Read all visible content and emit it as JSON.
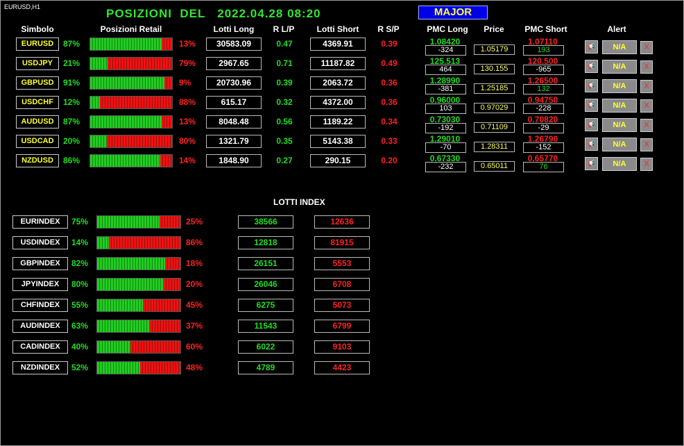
{
  "chart_label": "EURUSD,H1",
  "title": "POSIZIONI  DEL   2022.04.28 08:20",
  "group_button": "MAJOR",
  "headers": {
    "simbolo": "Simbolo",
    "posizioni_retail": "Posizioni Retail",
    "lotti_long": "Lotti Long",
    "r_lp": "R L/P",
    "lotti_short": "Lotti Short",
    "r_sp": "R S/P",
    "pmc_long": "PMC Long",
    "price": "Price",
    "pmc_short": "PMC Short",
    "alert": "Alert"
  },
  "rows": [
    {
      "symbol": "EURUSD",
      "long_pct": "87%",
      "short_pct": "13%",
      "long_frac": 0.87,
      "lotti_long": "30583.09",
      "r_lp": "0.47",
      "lotti_short": "4369.91",
      "r_sp": "0.39",
      "pmc_long": "1.08420",
      "pmc_long_diff": "-324",
      "price": "1.05179",
      "pmc_short": "1.07110",
      "pmc_short_diff": "193",
      "alert": "N/A"
    },
    {
      "symbol": "USDJPY",
      "long_pct": "21%",
      "short_pct": "79%",
      "long_frac": 0.21,
      "lotti_long": "2967.65",
      "r_lp": "0.71",
      "lotti_short": "11187.82",
      "r_sp": "0.49",
      "pmc_long": "125.513",
      "pmc_long_diff": "464",
      "price": "130.155",
      "pmc_short": "120.500",
      "pmc_short_diff": "-965",
      "alert": "N/A"
    },
    {
      "symbol": "GBPUSD",
      "long_pct": "91%",
      "short_pct": "9%",
      "long_frac": 0.91,
      "lotti_long": "20730.96",
      "r_lp": "0.39",
      "lotti_short": "2063.72",
      "r_sp": "0.36",
      "pmc_long": "1.28990",
      "pmc_long_diff": "-381",
      "price": "1.25185",
      "pmc_short": "1.26500",
      "pmc_short_diff": "132",
      "alert": "N/A"
    },
    {
      "symbol": "USDCHF",
      "long_pct": "12%",
      "short_pct": "88%",
      "long_frac": 0.12,
      "lotti_long": "615.17",
      "r_lp": "0.32",
      "lotti_short": "4372.00",
      "r_sp": "0.36",
      "pmc_long": "0.96000",
      "pmc_long_diff": "103",
      "price": "0.97029",
      "pmc_short": "0.94750",
      "pmc_short_diff": "-228",
      "alert": "N/A"
    },
    {
      "symbol": "AUDUSD",
      "long_pct": "87%",
      "short_pct": "13%",
      "long_frac": 0.87,
      "lotti_long": "8048.48",
      "r_lp": "0.56",
      "lotti_short": "1189.22",
      "r_sp": "0.34",
      "pmc_long": "0.73030",
      "pmc_long_diff": "-192",
      "price": "0.71109",
      "pmc_short": "0.70820",
      "pmc_short_diff": "-29",
      "alert": "N/A"
    },
    {
      "symbol": "USDCAD",
      "long_pct": "20%",
      "short_pct": "80%",
      "long_frac": 0.2,
      "lotti_long": "1321.79",
      "r_lp": "0.35",
      "lotti_short": "5143.38",
      "r_sp": "0.33",
      "pmc_long": "1.29010",
      "pmc_long_diff": "-70",
      "price": "1.28311",
      "pmc_short": "1.26790",
      "pmc_short_diff": "-152",
      "alert": "N/A"
    },
    {
      "symbol": "NZDUSD",
      "long_pct": "86%",
      "short_pct": "14%",
      "long_frac": 0.86,
      "lotti_long": "1848.90",
      "r_lp": "0.27",
      "lotti_short": "290.15",
      "r_sp": "0.20",
      "pmc_long": "0.67330",
      "pmc_long_diff": "-232",
      "price": "0.65011",
      "pmc_short": "0.65770",
      "pmc_short_diff": "76",
      "alert": "N/A"
    }
  ],
  "alert_icon": "bell-icon",
  "remove_label": "X",
  "lotti_index_title": "LOTTI INDEX",
  "indexes": [
    {
      "name": "EURINDEX",
      "long_pct": "75%",
      "short_pct": "25%",
      "long_frac": 0.75,
      "long_lots": "38566",
      "short_lots": "12636"
    },
    {
      "name": "USDINDEX",
      "long_pct": "14%",
      "short_pct": "86%",
      "long_frac": 0.14,
      "long_lots": "12818",
      "short_lots": "81915"
    },
    {
      "name": "GBPINDEX",
      "long_pct": "82%",
      "short_pct": "18%",
      "long_frac": 0.82,
      "long_lots": "26151",
      "short_lots": "5553"
    },
    {
      "name": "JPYINDEX",
      "long_pct": "80%",
      "short_pct": "20%",
      "long_frac": 0.8,
      "long_lots": "26046",
      "short_lots": "6708"
    },
    {
      "name": "CHFINDEX",
      "long_pct": "55%",
      "short_pct": "45%",
      "long_frac": 0.55,
      "long_lots": "6275",
      "short_lots": "5073"
    },
    {
      "name": "AUDINDEX",
      "long_pct": "63%",
      "short_pct": "37%",
      "long_frac": 0.63,
      "long_lots": "11543",
      "short_lots": "6799"
    },
    {
      "name": "CADINDEX",
      "long_pct": "40%",
      "short_pct": "60%",
      "long_frac": 0.4,
      "long_lots": "6022",
      "short_lots": "9103"
    },
    {
      "name": "NZDINDEX",
      "long_pct": "52%",
      "short_pct": "48%",
      "long_frac": 0.52,
      "long_lots": "4789",
      "short_lots": "4423"
    }
  ]
}
